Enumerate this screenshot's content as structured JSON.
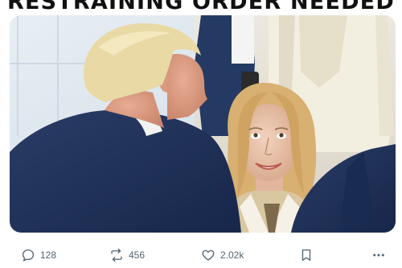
{
  "post": {
    "headline": "RESTRAINING ORDER NEEDED",
    "image": {
      "subjects": [
        "man-back-of-head",
        "smiling-woman"
      ],
      "colors": {
        "background_left": "#dfe7ee",
        "suit": "#1f3157",
        "woman_hair": "#d8b071",
        "woman_jacket": "#d9c7a1",
        "bystander": "#f3efe0"
      }
    },
    "actions": {
      "reply": {
        "icon": "reply-icon",
        "count": "128"
      },
      "repost": {
        "icon": "repost-icon",
        "count": "456"
      },
      "like": {
        "icon": "heart-icon",
        "count": "2.02k"
      },
      "bookmark": {
        "icon": "bookmark-icon"
      },
      "more": {
        "icon": "more-dots-icon"
      }
    }
  }
}
